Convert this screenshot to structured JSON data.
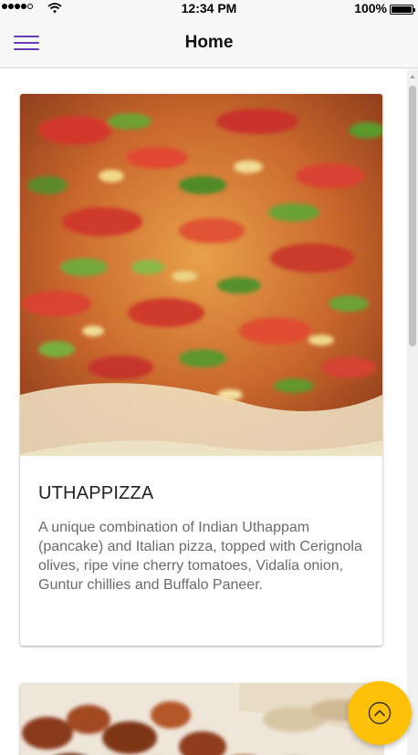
{
  "status_bar": {
    "time": "12:34 PM",
    "battery_percent": "100%",
    "signal_icon": "signal-dots-icon",
    "wifi_icon": "wifi-icon",
    "battery_icon": "battery-icon"
  },
  "nav": {
    "title": "Home",
    "menu_icon": "hamburger-menu-icon",
    "accent_color": "#673ab7"
  },
  "cards": [
    {
      "title": "UTHAPPIZZA",
      "description": "A unique combination of Indian Uthappam (pancake) and Italian pizza, topped with Cerignola olives, ripe vine cherry tomatoes, Vidalia onion, Guntur chillies and Buffalo Paneer.",
      "image": "uthappizza-photo"
    },
    {
      "title": "",
      "description": "",
      "image": "fried-dish-photo"
    }
  ],
  "fab": {
    "icon": "scroll-up-chevron-icon",
    "color": "#ffc107"
  }
}
